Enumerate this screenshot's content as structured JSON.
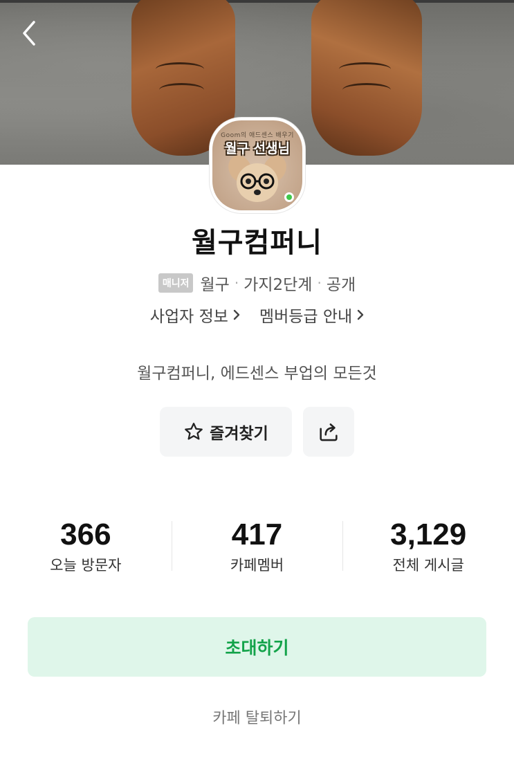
{
  "header": {
    "back_label": "뒤로"
  },
  "profile": {
    "avatar_subtitle": "Goom의 애드센스 배우기",
    "avatar_title": "월구 선생님",
    "cafe_name": "월구컴퍼니",
    "role_badge": "매니저",
    "manager_name": "월구",
    "level": "가지2단계",
    "visibility": "공개",
    "online": true
  },
  "links": {
    "business_info": "사업자 정보",
    "member_grade": "멤버등급 안내"
  },
  "description": "월구컴퍼니, 에드센스 부업의 모든것",
  "actions": {
    "favorite_label": "즐겨찾기",
    "share_icon": "share-icon"
  },
  "stats": [
    {
      "value": "366",
      "label": "오늘 방문자"
    },
    {
      "value": "417",
      "label": "카페멤버"
    },
    {
      "value": "3,129",
      "label": "전체 게시글"
    }
  ],
  "invite_label": "초대하기",
  "leave_label": "카페 탈퇴하기",
  "colors": {
    "accent_green": "#13a34a",
    "invite_bg": "#dff6ea",
    "online_dot": "#3fc94a"
  }
}
